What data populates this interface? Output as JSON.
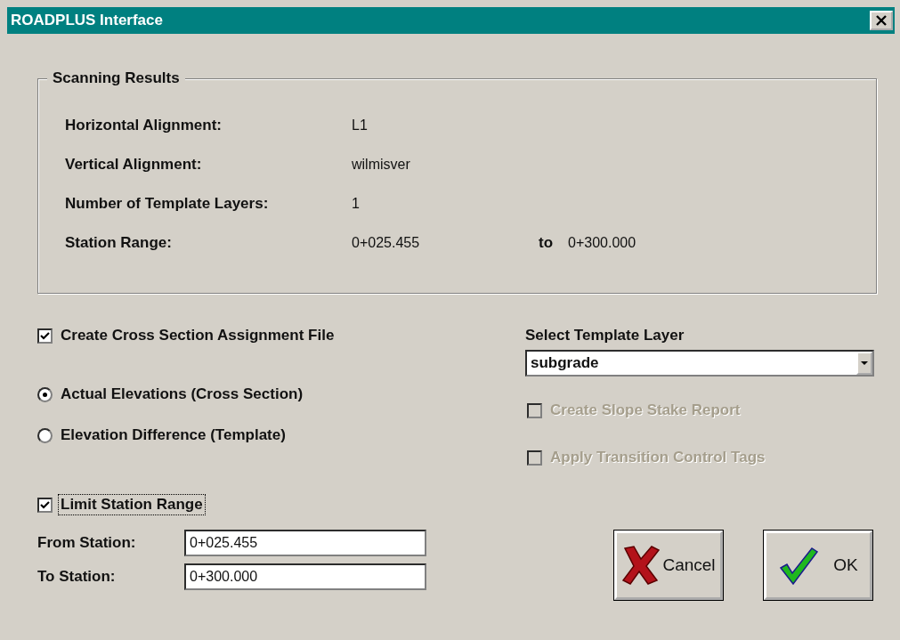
{
  "window": {
    "title": "ROADPLUS Interface"
  },
  "scanning_results": {
    "title": "Scanning Results",
    "rows": [
      {
        "label": "Horizontal Alignment:",
        "value": "L1"
      },
      {
        "label": "Vertical Alignment:",
        "value": "wilmisver"
      },
      {
        "label": "Number of Template Layers:",
        "value": "1"
      },
      {
        "label": "Station Range:",
        "value": "0+025.455",
        "to_label": "to",
        "to_value": "0+300.000"
      }
    ]
  },
  "create_assignment_file": {
    "label": "Create Cross Section Assignment File",
    "checked": true
  },
  "elevation_mode": [
    {
      "label": "Actual Elevations (Cross Section)",
      "selected": true
    },
    {
      "label": "Elevation Difference (Template)",
      "selected": false
    }
  ],
  "limit_station_range": {
    "label": "Limit Station Range",
    "checked": true,
    "focused": true
  },
  "station_fields": [
    {
      "label": "From Station:",
      "value": "0+025.455"
    },
    {
      "label": "To Station:",
      "value": "0+300.000"
    }
  ],
  "template_layer": {
    "label": "Select Template Layer",
    "value": "subgrade"
  },
  "report_options": [
    {
      "label": "Create Slope Stake Report",
      "checked": false,
      "disabled": true
    },
    {
      "label": "Apply Transition Control Tags",
      "checked": false,
      "disabled": true
    }
  ],
  "buttons": [
    {
      "kind": "cancel",
      "label": "Cancel"
    },
    {
      "kind": "ok",
      "label": "OK"
    }
  ]
}
